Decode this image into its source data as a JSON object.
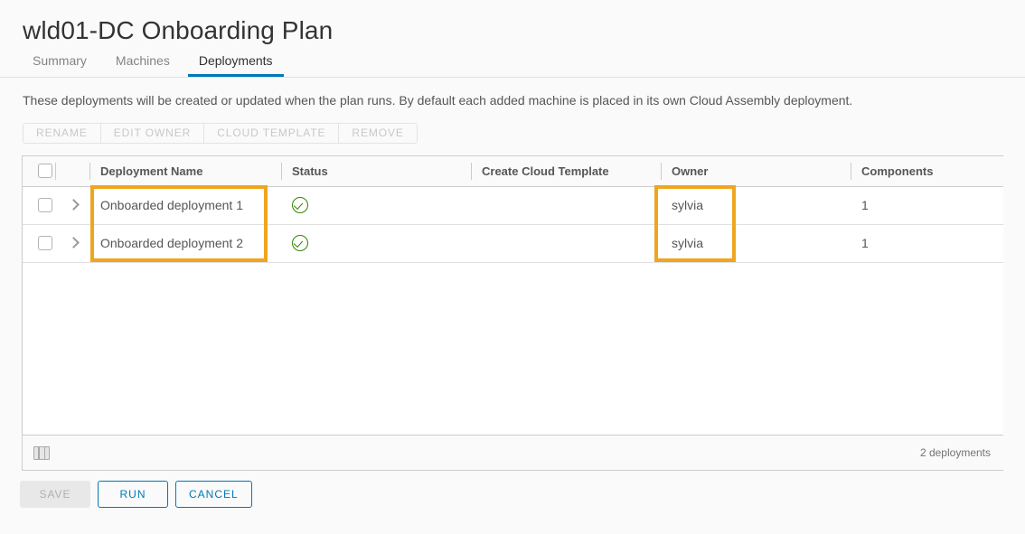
{
  "header": {
    "title": "wld01-DC Onboarding Plan",
    "tabs": [
      {
        "label": "Summary",
        "active": false
      },
      {
        "label": "Machines",
        "active": false
      },
      {
        "label": "Deployments",
        "active": true
      }
    ]
  },
  "description": "These deployments will be created or updated when the plan runs. By default each added machine is placed in its own Cloud Assembly deployment.",
  "toolbar": {
    "rename_label": "RENAME",
    "edit_owner_label": "EDIT OWNER",
    "cloud_template_label": "CLOUD TEMPLATE",
    "remove_label": "REMOVE"
  },
  "table": {
    "columns": [
      "Deployment Name",
      "Status",
      "Create Cloud Template",
      "Owner",
      "Components"
    ],
    "rows": [
      {
        "name": "Onboarded deployment 1",
        "status": "ok",
        "create_cloud_template": "",
        "owner": "sylvia",
        "components": "1"
      },
      {
        "name": "Onboarded deployment 2",
        "status": "ok",
        "create_cloud_template": "",
        "owner": "sylvia",
        "components": "1"
      }
    ],
    "footer_count": "2 deployments"
  },
  "actions": {
    "save_label": "SAVE",
    "run_label": "RUN",
    "cancel_label": "CANCEL"
  },
  "colors": {
    "accent": "#0079b8",
    "annotation": "#f0a51e",
    "status_ok": "#318700",
    "page_bg": "#fafafa"
  }
}
